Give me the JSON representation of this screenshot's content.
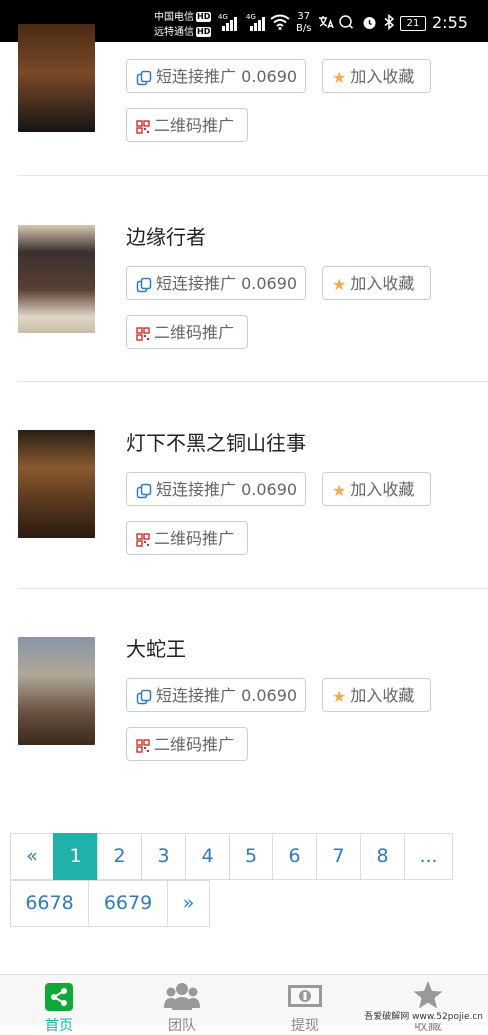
{
  "status_bar": {
    "carrier1": "中国电信",
    "carrier2": "远特通信",
    "hd_badge": "HD",
    "signal_label": "4G",
    "speed_value": "37",
    "speed_unit": "B/s",
    "battery": "21",
    "time": "2:55"
  },
  "buttons": {
    "short_link": "短连接推广 0.0690",
    "favorite": "加入收藏",
    "qrcode": "二维码推广"
  },
  "items": [
    {
      "title": "",
      "poster_colors": [
        "#5a3a20",
        "#1a1a18"
      ]
    },
    {
      "title": "边缘行者",
      "poster_colors": [
        "#2a2a2a",
        "#8a6a4a"
      ]
    },
    {
      "title": "灯下不黑之铜山往事",
      "poster_colors": [
        "#6a4a2a",
        "#3a2a1a"
      ]
    },
    {
      "title": "大蛇王",
      "poster_colors": [
        "#8a8a9a",
        "#4a3a2a"
      ]
    }
  ],
  "pagination": {
    "prev": "«",
    "pages": [
      "1",
      "2",
      "3",
      "4",
      "5",
      "6",
      "7",
      "8",
      "..."
    ],
    "last_pages": [
      "6678",
      "6679"
    ],
    "next": "»",
    "active": "1"
  },
  "tabbar": {
    "tabs": [
      {
        "label": "首页",
        "icon": "share-icon"
      },
      {
        "label": "团队",
        "icon": "team-icon"
      },
      {
        "label": "提现",
        "icon": "cash-icon"
      },
      {
        "label": "收藏",
        "icon": "star-icon"
      }
    ]
  },
  "watermark": "吾爱破解网 www.52pojie.cn",
  "colors": {
    "accent": "#20b2aa",
    "link": "#337ab7",
    "star": "#f0ad4e",
    "qrcode": "#c9302c"
  }
}
